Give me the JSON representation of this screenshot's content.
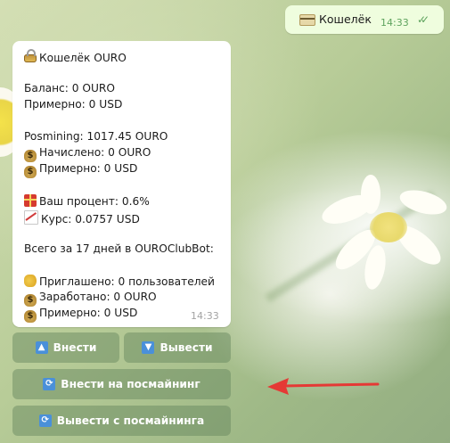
{
  "outgoing_message": {
    "text": "Кошелёк",
    "time": "14:33",
    "status": "read"
  },
  "incoming_message": {
    "title": "Кошелёк OURO",
    "balance": "Баланс: 0 OURO",
    "approx_1": "Примерно: 0 USD",
    "posmining": "Posmining: 1017.45 OURO",
    "accrued": "Начислено: 0 OURO",
    "approx_2": "Примерно: 0 USD",
    "percent": "Ваш процент: 0.6%",
    "rate": "Курс: 0.0757 USD",
    "total": "Всего за 17 дней в OUROClubBot:",
    "invited": "Приглашено: 0 пользователей",
    "earned": "Заработано: 0 OURO",
    "approx_3": "Примерно: 0 USD",
    "time": "14:33"
  },
  "keyboard": {
    "deposit": "Внести",
    "withdraw": "Вывести",
    "deposit_posmining": "Внести на посмайнинг",
    "withdraw_posmining": "Вывести с посмайнинга"
  },
  "icons": {
    "outgoing": "credit-card-icon",
    "title": "lock-icon",
    "money": "money-bag-icon",
    "gift": "gift-icon",
    "chart": "chart-icon",
    "handshake": "handshake-icon",
    "up": "arrow-up-icon",
    "down": "arrow-down-icon",
    "refresh": "refresh-icon"
  },
  "colors": {
    "outgoing_bubble": "#effdde",
    "incoming_bubble": "#ffffff",
    "button_bg": "#62825a",
    "accent_blue": "#4a90d9",
    "arrow": "#e53935",
    "read_checks": "#5ea35e"
  }
}
